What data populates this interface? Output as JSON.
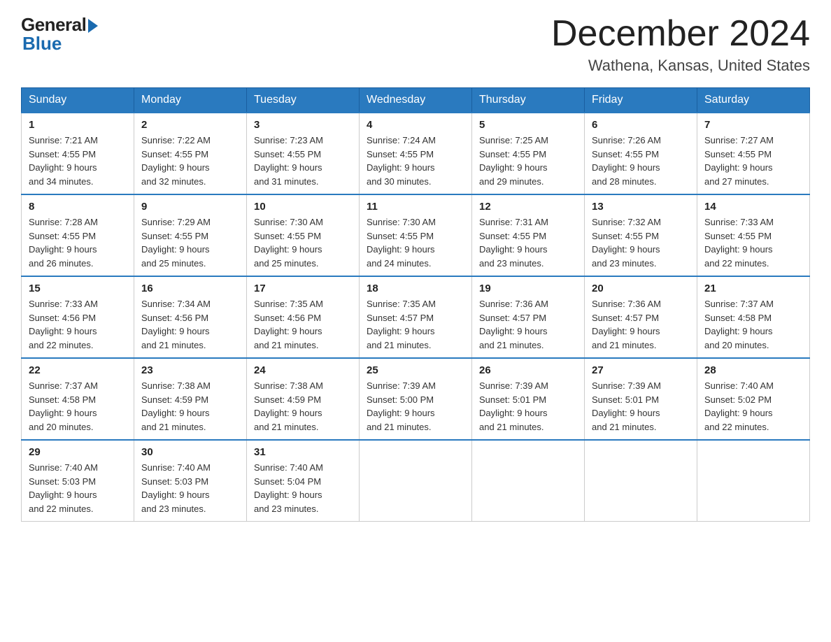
{
  "logo": {
    "general": "General",
    "blue": "Blue"
  },
  "title": "December 2024",
  "subtitle": "Wathena, Kansas, United States",
  "days_of_week": [
    "Sunday",
    "Monday",
    "Tuesday",
    "Wednesday",
    "Thursday",
    "Friday",
    "Saturday"
  ],
  "weeks": [
    [
      {
        "day": "1",
        "sunrise": "7:21 AM",
        "sunset": "4:55 PM",
        "daylight": "9 hours and 34 minutes."
      },
      {
        "day": "2",
        "sunrise": "7:22 AM",
        "sunset": "4:55 PM",
        "daylight": "9 hours and 32 minutes."
      },
      {
        "day": "3",
        "sunrise": "7:23 AM",
        "sunset": "4:55 PM",
        "daylight": "9 hours and 31 minutes."
      },
      {
        "day": "4",
        "sunrise": "7:24 AM",
        "sunset": "4:55 PM",
        "daylight": "9 hours and 30 minutes."
      },
      {
        "day": "5",
        "sunrise": "7:25 AM",
        "sunset": "4:55 PM",
        "daylight": "9 hours and 29 minutes."
      },
      {
        "day": "6",
        "sunrise": "7:26 AM",
        "sunset": "4:55 PM",
        "daylight": "9 hours and 28 minutes."
      },
      {
        "day": "7",
        "sunrise": "7:27 AM",
        "sunset": "4:55 PM",
        "daylight": "9 hours and 27 minutes."
      }
    ],
    [
      {
        "day": "8",
        "sunrise": "7:28 AM",
        "sunset": "4:55 PM",
        "daylight": "9 hours and 26 minutes."
      },
      {
        "day": "9",
        "sunrise": "7:29 AM",
        "sunset": "4:55 PM",
        "daylight": "9 hours and 25 minutes."
      },
      {
        "day": "10",
        "sunrise": "7:30 AM",
        "sunset": "4:55 PM",
        "daylight": "9 hours and 25 minutes."
      },
      {
        "day": "11",
        "sunrise": "7:30 AM",
        "sunset": "4:55 PM",
        "daylight": "9 hours and 24 minutes."
      },
      {
        "day": "12",
        "sunrise": "7:31 AM",
        "sunset": "4:55 PM",
        "daylight": "9 hours and 23 minutes."
      },
      {
        "day": "13",
        "sunrise": "7:32 AM",
        "sunset": "4:55 PM",
        "daylight": "9 hours and 23 minutes."
      },
      {
        "day": "14",
        "sunrise": "7:33 AM",
        "sunset": "4:55 PM",
        "daylight": "9 hours and 22 minutes."
      }
    ],
    [
      {
        "day": "15",
        "sunrise": "7:33 AM",
        "sunset": "4:56 PM",
        "daylight": "9 hours and 22 minutes."
      },
      {
        "day": "16",
        "sunrise": "7:34 AM",
        "sunset": "4:56 PM",
        "daylight": "9 hours and 21 minutes."
      },
      {
        "day": "17",
        "sunrise": "7:35 AM",
        "sunset": "4:56 PM",
        "daylight": "9 hours and 21 minutes."
      },
      {
        "day": "18",
        "sunrise": "7:35 AM",
        "sunset": "4:57 PM",
        "daylight": "9 hours and 21 minutes."
      },
      {
        "day": "19",
        "sunrise": "7:36 AM",
        "sunset": "4:57 PM",
        "daylight": "9 hours and 21 minutes."
      },
      {
        "day": "20",
        "sunrise": "7:36 AM",
        "sunset": "4:57 PM",
        "daylight": "9 hours and 21 minutes."
      },
      {
        "day": "21",
        "sunrise": "7:37 AM",
        "sunset": "4:58 PM",
        "daylight": "9 hours and 20 minutes."
      }
    ],
    [
      {
        "day": "22",
        "sunrise": "7:37 AM",
        "sunset": "4:58 PM",
        "daylight": "9 hours and 20 minutes."
      },
      {
        "day": "23",
        "sunrise": "7:38 AM",
        "sunset": "4:59 PM",
        "daylight": "9 hours and 21 minutes."
      },
      {
        "day": "24",
        "sunrise": "7:38 AM",
        "sunset": "4:59 PM",
        "daylight": "9 hours and 21 minutes."
      },
      {
        "day": "25",
        "sunrise": "7:39 AM",
        "sunset": "5:00 PM",
        "daylight": "9 hours and 21 minutes."
      },
      {
        "day": "26",
        "sunrise": "7:39 AM",
        "sunset": "5:01 PM",
        "daylight": "9 hours and 21 minutes."
      },
      {
        "day": "27",
        "sunrise": "7:39 AM",
        "sunset": "5:01 PM",
        "daylight": "9 hours and 21 minutes."
      },
      {
        "day": "28",
        "sunrise": "7:40 AM",
        "sunset": "5:02 PM",
        "daylight": "9 hours and 22 minutes."
      }
    ],
    [
      {
        "day": "29",
        "sunrise": "7:40 AM",
        "sunset": "5:03 PM",
        "daylight": "9 hours and 22 minutes."
      },
      {
        "day": "30",
        "sunrise": "7:40 AM",
        "sunset": "5:03 PM",
        "daylight": "9 hours and 23 minutes."
      },
      {
        "day": "31",
        "sunrise": "7:40 AM",
        "sunset": "5:04 PM",
        "daylight": "9 hours and 23 minutes."
      },
      null,
      null,
      null,
      null
    ]
  ],
  "labels": {
    "sunrise": "Sunrise:",
    "sunset": "Sunset:",
    "daylight": "Daylight:"
  }
}
